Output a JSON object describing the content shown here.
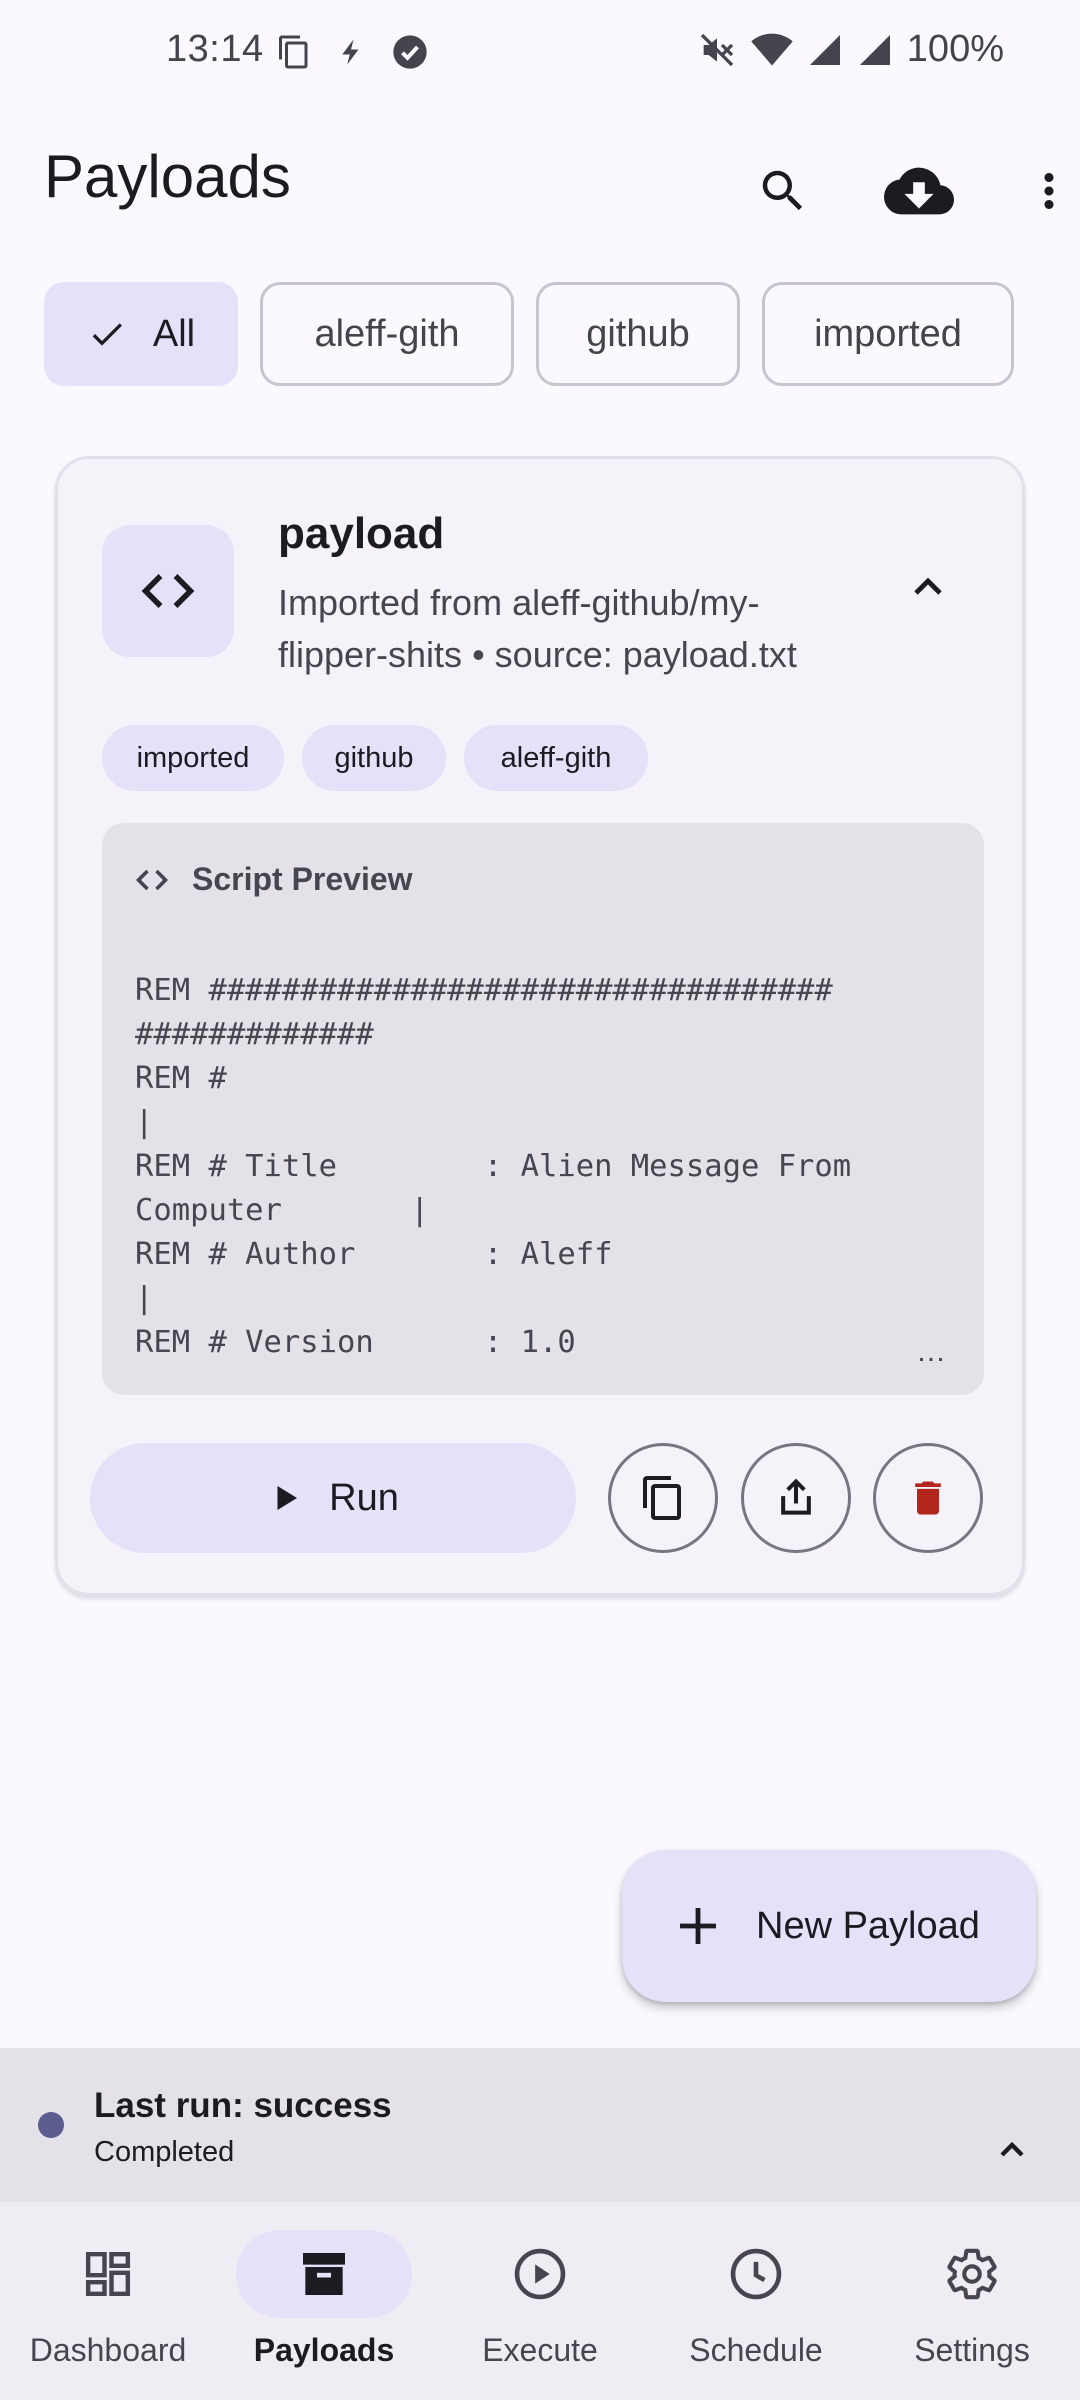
{
  "status_bar": {
    "time": "13:14",
    "battery": "100%",
    "icons": [
      "copy-icon",
      "bolt-icon",
      "check-circle-icon",
      "mute-icon",
      "wifi-icon",
      "signal-icon",
      "signal-icon"
    ]
  },
  "app_bar": {
    "title": "Payloads",
    "actions": [
      "search-icon",
      "cloud-download-icon",
      "more-vert-icon"
    ]
  },
  "filters": {
    "chips": [
      {
        "label": "All",
        "selected": true
      },
      {
        "label": "aleff-gith",
        "selected": false
      },
      {
        "label": "github",
        "selected": false
      },
      {
        "label": "imported",
        "selected": false
      }
    ]
  },
  "payload_card": {
    "name": "payload",
    "description": "Imported from aleff-github/my-flipper-shits • source: payload.txt",
    "tags": [
      "imported",
      "github",
      "aleff-gith"
    ],
    "preview": {
      "title": "Script Preview",
      "lines": [
        "REM ##################################",
        "#############",
        "REM #",
        "|",
        "REM # Title        : Alien Message From",
        "Computer       |",
        "REM # Author       : Aleff",
        "|",
        "REM # Version      : 1.0"
      ],
      "ellipsis": "…"
    },
    "run_label": "Run"
  },
  "fab": {
    "label": "New Payload"
  },
  "last_run": {
    "title": "Last run: success",
    "subtitle": "Completed"
  },
  "bottom_nav": {
    "items": [
      {
        "label": "Dashboard",
        "icon": "dashboard-icon",
        "active": false
      },
      {
        "label": "Payloads",
        "icon": "archive-icon",
        "active": true
      },
      {
        "label": "Execute",
        "icon": "play-circle-icon",
        "active": false
      },
      {
        "label": "Schedule",
        "icon": "clock-icon",
        "active": false
      },
      {
        "label": "Settings",
        "icon": "settings-icon",
        "active": false
      }
    ]
  },
  "colors": {
    "background": "#fbf8ff",
    "accent_container": "#e4e1f9",
    "surface_variant": "#e4e1e9",
    "delete_red": "#b3261e",
    "status_dot": "#5d5c8f"
  }
}
